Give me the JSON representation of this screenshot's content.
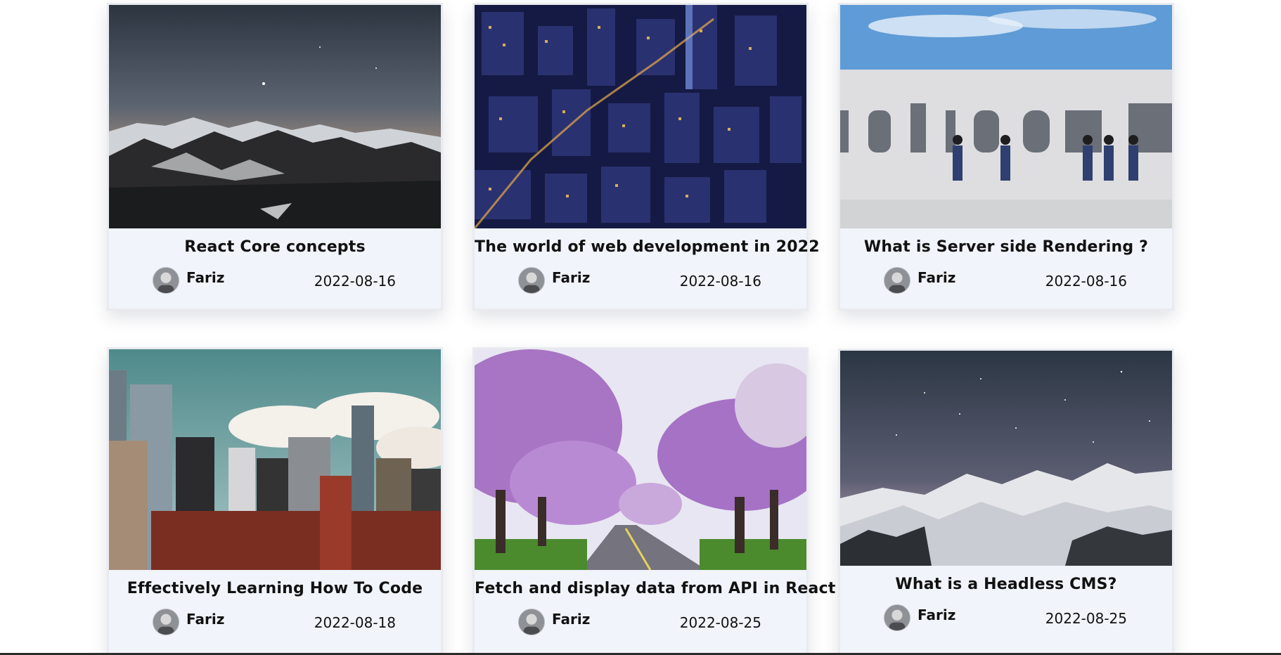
{
  "posts": [
    {
      "title": "React Core concepts",
      "author": "Fariz",
      "date": "2022-08-16",
      "image_icon": "mountain-night-image"
    },
    {
      "title": "The world of web development in 2022",
      "author": "Fariz",
      "date": "2022-08-16",
      "image_icon": "city-aerial-night-image"
    },
    {
      "title": "What is Server side Rendering ?",
      "author": "Fariz",
      "date": "2022-08-16",
      "image_icon": "mural-wall-image"
    },
    {
      "title": "Effectively Learning How To Code",
      "author": "Fariz",
      "date": "2022-08-18",
      "image_icon": "city-skyline-image"
    },
    {
      "title": "Fetch and display data from API in React",
      "author": "Fariz",
      "date": "2022-08-25",
      "image_icon": "cherry-blossom-road-image"
    },
    {
      "title": "What is a Headless CMS?",
      "author": "Fariz",
      "date": "2022-08-25",
      "image_icon": "snowy-mountain-stars-image"
    }
  ],
  "colors": {
    "card_background": "#f1f4fa",
    "card_border": "#e9ebef",
    "text": "#111111"
  }
}
